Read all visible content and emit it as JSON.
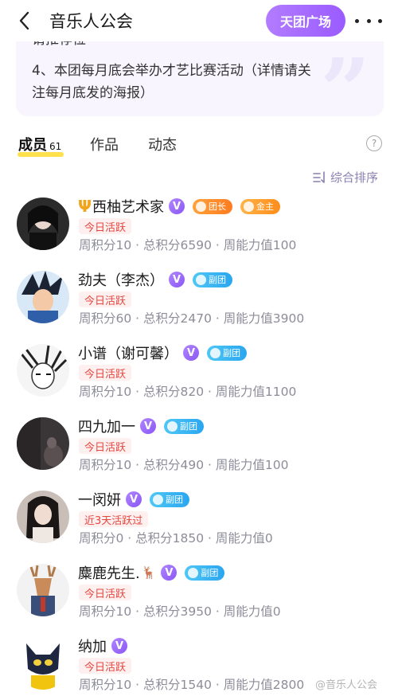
{
  "header": {
    "title": "音乐人公会",
    "action_button": "天团广场"
  },
  "notice": {
    "clipped_line": "请推荐位",
    "line1": "4、本团每月底会举办才艺比赛活动（详情请关",
    "line2": "注每月底发的海报）"
  },
  "tabs": {
    "members_label": "成员",
    "members_count": "61",
    "works_label": "作品",
    "feed_label": "动态",
    "help": "?"
  },
  "sort": {
    "label": "综合排序"
  },
  "members": [
    {
      "name": "西柚艺术家",
      "prefix": "Ψ",
      "verified": "V",
      "roles": [
        {
          "label": "团长",
          "kind": "leader"
        },
        {
          "label": "金主",
          "kind": "gold"
        }
      ],
      "activity": "今日活跃",
      "stats": "周积分10 · 总积分6590 · 周能力值100"
    },
    {
      "name": "劲夫（李杰）",
      "verified": "V",
      "roles": [
        {
          "label": "副团",
          "kind": "vice"
        }
      ],
      "activity": "今日活跃",
      "stats": "周积分60 · 总积分2470 · 周能力值3900"
    },
    {
      "name": "小谱（谢可馨）",
      "verified": "V",
      "roles": [
        {
          "label": "副团",
          "kind": "vice"
        }
      ],
      "activity": "今日活跃",
      "stats": "周积分10 · 总积分820 · 周能力值1100"
    },
    {
      "name": "四九加一",
      "verified": "V",
      "roles": [
        {
          "label": "副团",
          "kind": "vice"
        }
      ],
      "activity": "今日活跃",
      "stats": "周积分10 · 总积分490 · 周能力值100"
    },
    {
      "name": "一闵妍",
      "verified": "V",
      "roles": [
        {
          "label": "副团",
          "kind": "vice"
        }
      ],
      "activity": "近3天活跃过",
      "stats": "周积分0 · 总积分1850 · 周能力值0"
    },
    {
      "name": "麋鹿先生.",
      "suffix": "🦌",
      "verified": "V",
      "roles": [
        {
          "label": "副团",
          "kind": "vice"
        }
      ],
      "activity": "今日活跃",
      "stats": "周积分10 · 总积分3950 · 周能力值0"
    },
    {
      "name": "纳加",
      "verified": "V",
      "roles": [],
      "activity": "今日活跃",
      "stats": "周积分10 · 总积分1540 · 周能力值2800"
    }
  ],
  "watermark": "@音乐人公会",
  "colors": {
    "accent": "#9a5bff",
    "active_tag_bg": "#fff0f0",
    "active_tag_text": "#e6463f",
    "tab_underline": "#ffe14d"
  }
}
